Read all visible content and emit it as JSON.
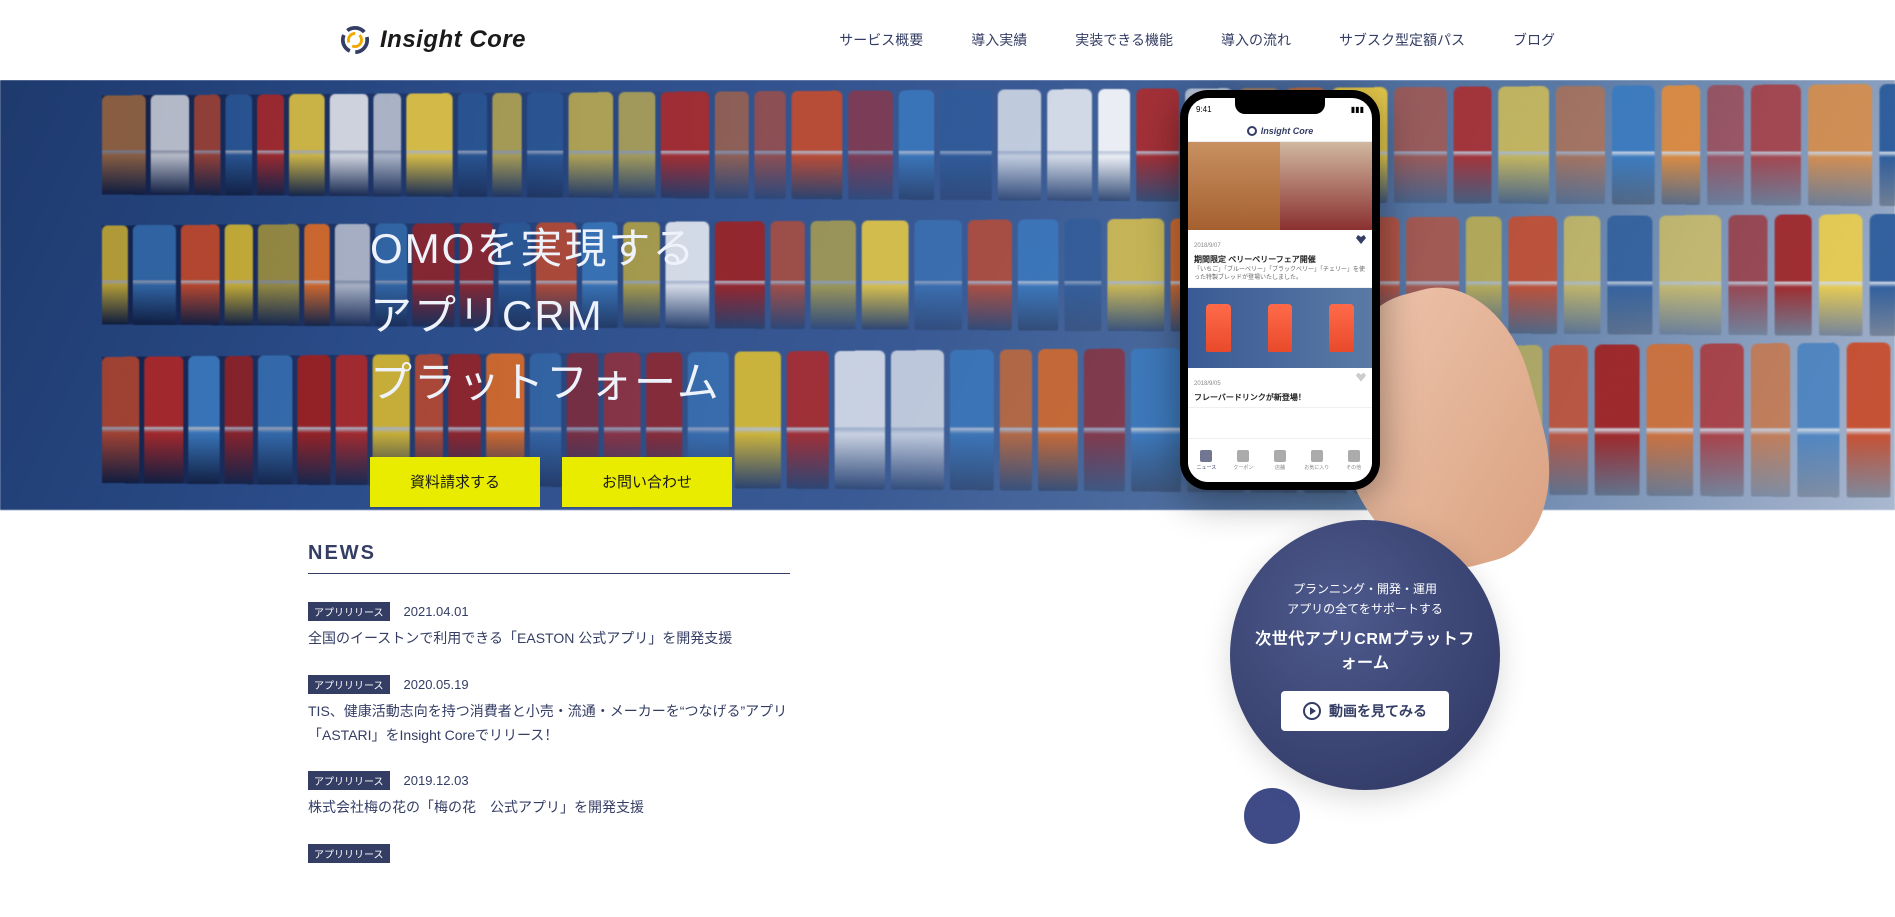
{
  "header": {
    "brand": "Insight Core",
    "nav": [
      "サービス概要",
      "導入実績",
      "実装できる機能",
      "導入の流れ",
      "サブスク型定額パス",
      "ブログ"
    ]
  },
  "hero": {
    "line1": "OMOを実現する",
    "line2": "アプリCRM",
    "line3": "プラットフォーム",
    "btn_request": "資料請求する",
    "btn_contact": "お問い合わせ"
  },
  "phone": {
    "time": "9:41",
    "app_brand": "Insight Core",
    "card1": {
      "date": "2018/9/07",
      "title": "期間限定 ベリーベリーフェア開催",
      "desc": "「いちご」「ブルーベリー」「ブラックベリー」「チェリー」を使った特製ブレッドが登場いたしました。"
    },
    "card2": {
      "date": "2018/9/05",
      "title": "フレーバードリンクが新登場！"
    },
    "tabs": [
      "ニュース",
      "クーポン",
      "店舗",
      "お気に入り",
      "その他"
    ]
  },
  "circle": {
    "sub1": "プランニング・開発・運用",
    "sub2": "アプリの全てをサポートする",
    "main": "次世代アプリCRMプラットフォーム",
    "btn": "動画を見てみる"
  },
  "news": {
    "heading": "NEWS",
    "tag": "アプリリリース",
    "items": [
      {
        "date": "2021.04.01",
        "title": "全国のイーストンで利用できる「EASTON 公式アプリ」を開発支援"
      },
      {
        "date": "2020.05.19",
        "title": "TIS、健康活動志向を持つ消費者と小売・流通・メーカーを“つなげる”アプリ「ASTARI」をInsight Coreでリリース！"
      },
      {
        "date": "2019.12.03",
        "title": "株式会社梅の花の「梅の花　公式アプリ」を開発支援"
      }
    ]
  }
}
